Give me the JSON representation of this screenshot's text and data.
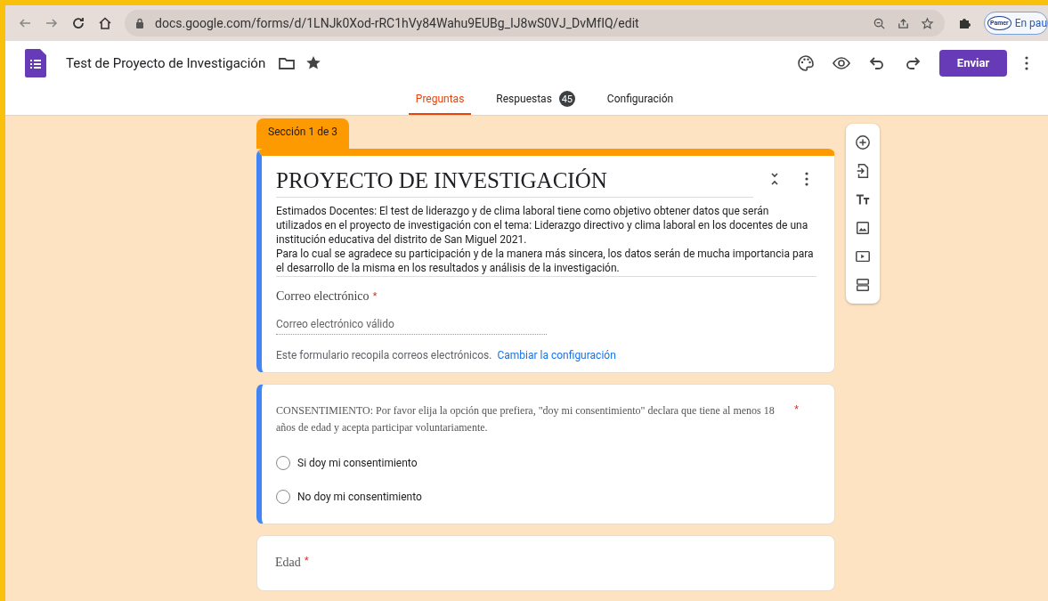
{
  "required_mark": "*",
  "browser": {
    "url": "docs.google.com/forms/d/1LNJk0Xod-rRC1hVy84Wahu9EUBg_IJ8wS0VJ_DvMfIQ/edit",
    "profile_badge": "Pamer",
    "profile_label": "En pau"
  },
  "app": {
    "title": "Test de Proyecto de Investigación",
    "send_button": "Enviar"
  },
  "tabs": [
    {
      "label": "Preguntas",
      "selected": true
    },
    {
      "label": "Respuestas",
      "selected": false,
      "count": "45"
    },
    {
      "label": "Configuración",
      "selected": false
    }
  ],
  "section": {
    "label": "Sección 1 de 3",
    "title": "PROYECTO DE INVESTIGACIÓN",
    "description": [
      "Estimados Docentes: El test de liderazgo y de clima laboral tiene como objetivo obtener datos que serán utilizados en el proyecto de investigación con el tema: Liderazgo directivo y clima laboral en los docentes de una institución educativa del distrito de San Miguel 2021.",
      "Para lo cual se agradece su participación y de la manera más sincera, los datos serán de mucha importancia para el desarrollo de la misma en los resultados y análisis de la investigación."
    ],
    "email_label": "Correo electrónico",
    "email_required": true,
    "email_placeholder": "Correo electrónico válido",
    "email_note": "Este formulario recopila correos electrónicos.",
    "email_link": "Cambiar la configuración"
  },
  "questions": [
    {
      "kind": "radio",
      "title": "CONSENTIMIENTO: Por favor elija la opción que prefiera, \"doy mi consentimiento\" declara que tiene al menos 18 años de edad y acepta participar voluntariamente.",
      "required": true,
      "active": true,
      "options": [
        {
          "label": "Si doy mi consentimiento",
          "selected": false
        },
        {
          "label": "No doy mi consentimiento",
          "selected": false
        }
      ]
    },
    {
      "kind": "text",
      "title": "Edad",
      "required": true,
      "active": false
    }
  ]
}
